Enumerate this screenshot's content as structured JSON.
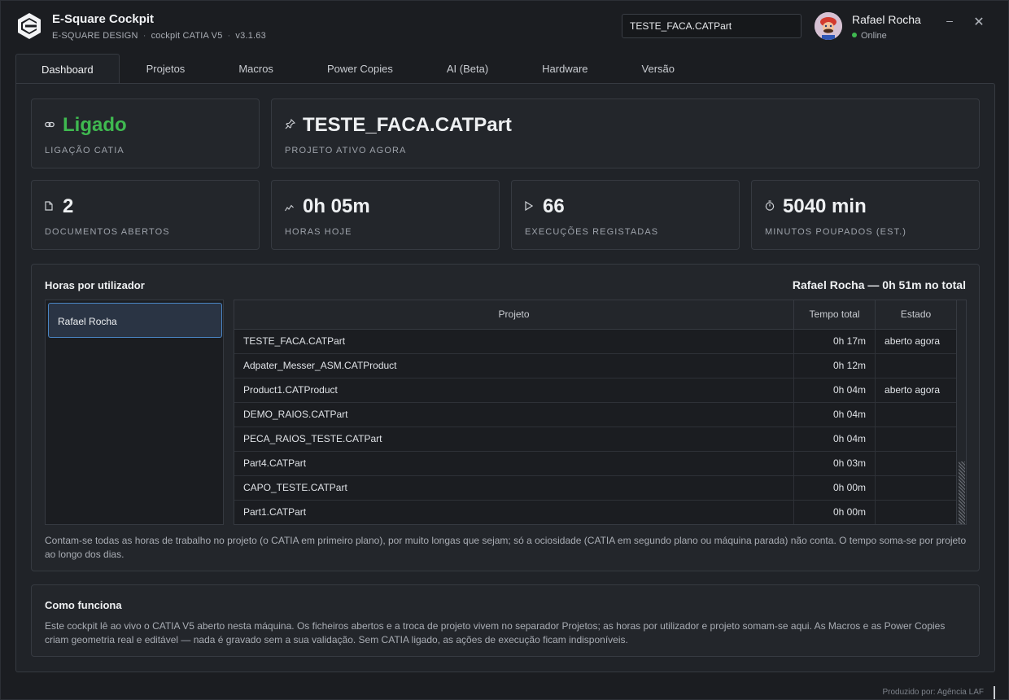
{
  "app": {
    "title": "E-Square Cockpit",
    "company": "E-SQUARE DESIGN",
    "product": "cockpit CATIA V5",
    "version": "v3.1.63",
    "separator": "·"
  },
  "search": {
    "value": "TESTE_FACA.CATPart"
  },
  "user": {
    "name": "Rafael Rocha",
    "status": "Online",
    "status_color": "#3fb950"
  },
  "window_controls": {
    "minimize": "–",
    "close": "✕"
  },
  "tabs": [
    {
      "label": "Dashboard",
      "active": true
    },
    {
      "label": "Projetos"
    },
    {
      "label": "Macros"
    },
    {
      "label": "Power Copies"
    },
    {
      "label": "AI (Beta)"
    },
    {
      "label": "Hardware"
    },
    {
      "label": "Versão"
    }
  ],
  "cards": {
    "connection": {
      "icon": "link-icon",
      "value": "Ligado",
      "label": "LIGAÇÃO CATIA",
      "value_color": "#3fb950"
    },
    "project": {
      "icon": "pin-icon",
      "value": "TESTE_FACA.CATPart",
      "label": "PROJETO ATIVO AGORA"
    },
    "documents": {
      "icon": "document-icon",
      "value": "2",
      "label": "DOCUMENTOS ABERTOS"
    },
    "hours": {
      "icon": "activity-icon",
      "value": "0h 05m",
      "label": "HORAS HOJE"
    },
    "executions": {
      "icon": "play-icon",
      "value": "66",
      "label": "EXECUÇÕES REGISTADAS"
    },
    "minutes": {
      "icon": "stopwatch-icon",
      "value": "5040 min",
      "label": "MINUTOS POUPADOS (EST.)"
    }
  },
  "hours_section": {
    "title": "Horas por utilizador",
    "total": "Rafael Rocha — 0h 51m no total",
    "users": [
      "Rafael Rocha"
    ],
    "columns": [
      "Projeto",
      "Tempo total",
      "Estado"
    ],
    "rows": [
      {
        "project": "TESTE_FACA.CATPart",
        "time": "0h 17m",
        "state": "aberto agora"
      },
      {
        "project": "Adpater_Messer_ASM.CATProduct",
        "time": "0h 12m",
        "state": ""
      },
      {
        "project": "Product1.CATProduct",
        "time": "0h 04m",
        "state": "aberto agora"
      },
      {
        "project": "DEMO_RAIOS.CATPart",
        "time": "0h 04m",
        "state": ""
      },
      {
        "project": "PECA_RAIOS_TESTE.CATPart",
        "time": "0h 04m",
        "state": ""
      },
      {
        "project": "Part4.CATPart",
        "time": "0h 03m",
        "state": ""
      },
      {
        "project": "CAPO_TESTE.CATPart",
        "time": "0h 00m",
        "state": ""
      },
      {
        "project": "Part1.CATPart",
        "time": "0h 00m",
        "state": ""
      }
    ],
    "note": "Contam-se todas as horas de trabalho no projeto (o CATIA em primeiro plano), por muito longas que sejam; só a ociosidade (CATIA em segundo plano ou máquina parada) não conta. O tempo soma-se por projeto ao longo dos dias."
  },
  "how": {
    "title": "Como funciona",
    "text": "Este cockpit lê ao vivo o CATIA V5 aberto nesta máquina. Os ficheiros abertos e a troca de projeto vivem no separador Projetos; as horas por utilizador e projeto somam-se aqui. As Macros e as Power Copies criam geometria real e editável — nada é gravado sem a sua validação. Sem CATIA ligado, as ações de execução ficam indisponíveis."
  },
  "footer": {
    "text": "Produzido por: Agência LAF"
  }
}
